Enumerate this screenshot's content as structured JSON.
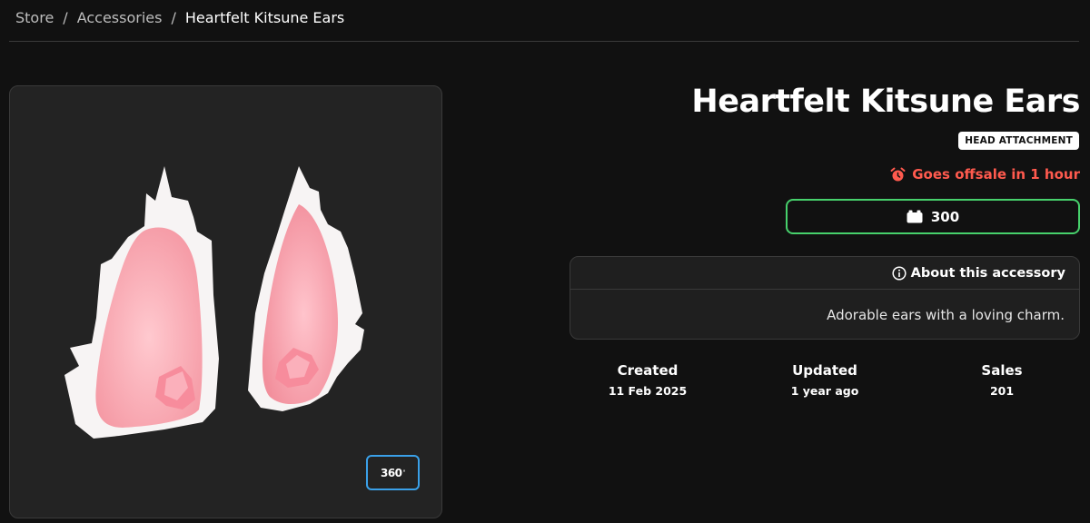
{
  "breadcrumb": {
    "items": [
      "Store",
      "Accessories"
    ],
    "separator": "/",
    "current": "Heartfelt Kitsune Ears"
  },
  "preview": {
    "toggle_label": "360",
    "toggle_sup": "°"
  },
  "item": {
    "title": "Heartfelt Kitsune Ears",
    "type_badge": "HEAD ATTACHMENT",
    "offsale_notice": "Goes offsale in 1 hour",
    "price": "300",
    "price_icon": "currency-icon"
  },
  "about": {
    "header": "About this accessory",
    "description": "Adorable ears with a loving charm."
  },
  "stats": {
    "created_label": "Created",
    "created_value": "11 Feb 2025",
    "updated_label": "Updated",
    "updated_value": "1 year ago",
    "sales_label": "Sales",
    "sales_value": "201"
  },
  "colors": {
    "background": "#111111",
    "panel": "#232323",
    "accent_green": "#47d16c",
    "accent_blue": "#3aa0e8",
    "warning_red": "#ff5a4e"
  }
}
